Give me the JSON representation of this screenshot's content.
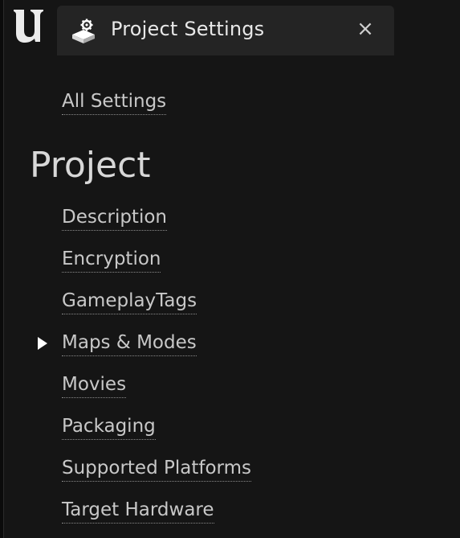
{
  "tab": {
    "title": "Project Settings",
    "close_glyph": "×",
    "icon": "settings-cube-icon"
  },
  "logo": {
    "icon": "unreal-logo-icon"
  },
  "all_settings_label": "All Settings",
  "section": {
    "title": "Project",
    "items": [
      {
        "label": "Description"
      },
      {
        "label": "Encryption"
      },
      {
        "label": "GameplayTags"
      },
      {
        "label": "Maps & Modes",
        "selected": true
      },
      {
        "label": "Movies"
      },
      {
        "label": "Packaging"
      },
      {
        "label": "Supported Platforms"
      },
      {
        "label": "Target Hardware"
      }
    ]
  },
  "colors": {
    "background": "#151515",
    "tab_background": "#242424",
    "text": "#c8c8c8"
  }
}
